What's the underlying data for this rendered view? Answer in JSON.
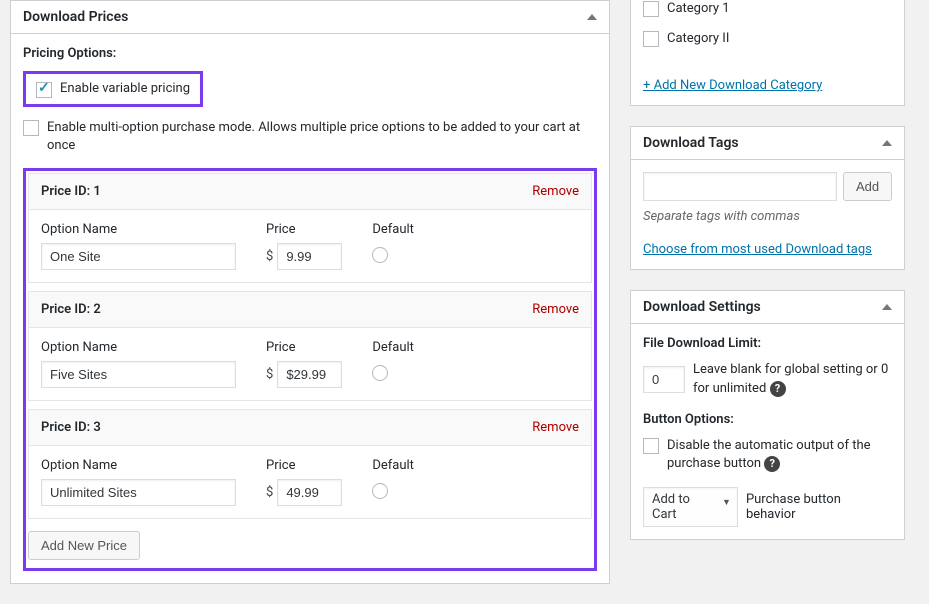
{
  "prices_box": {
    "title": "Download Prices",
    "pricing_options_label": "Pricing Options:",
    "variable_pricing_label": "Enable variable pricing",
    "multi_option_label": "Enable multi-option purchase mode. Allows multiple price options to be added to your cart at once",
    "option_name_label": "Option Name",
    "price_label": "Price",
    "default_label": "Default",
    "remove_label": "Remove",
    "currency_symbol": "$",
    "add_new_price_label": "Add New Price",
    "rows": [
      {
        "id_label": "Price ID: 1",
        "name": "One Site",
        "price": "9.99"
      },
      {
        "id_label": "Price ID: 2",
        "name": "Five Sites",
        "price": "$29.99"
      },
      {
        "id_label": "Price ID: 3",
        "name": "Unlimited Sites",
        "price": "49.99"
      }
    ]
  },
  "categories_box": {
    "items": [
      {
        "label": "Category 1"
      },
      {
        "label": "Category II"
      }
    ],
    "add_new_link": "+ Add New Download Category"
  },
  "tags_box": {
    "title": "Download Tags",
    "add_label": "Add",
    "separator_hint": "Separate tags with commas",
    "choose_link": "Choose from most used Download tags"
  },
  "settings_box": {
    "title": "Download Settings",
    "file_limit_label": "File Download Limit:",
    "file_limit_value": "0",
    "file_limit_hint": "Leave blank for global setting or 0 for unlimited",
    "button_options_label": "Button Options:",
    "disable_button_label": "Disable the automatic output of the purchase button",
    "behavior_select": "Add to Cart",
    "behavior_label": "Purchase button behavior"
  }
}
